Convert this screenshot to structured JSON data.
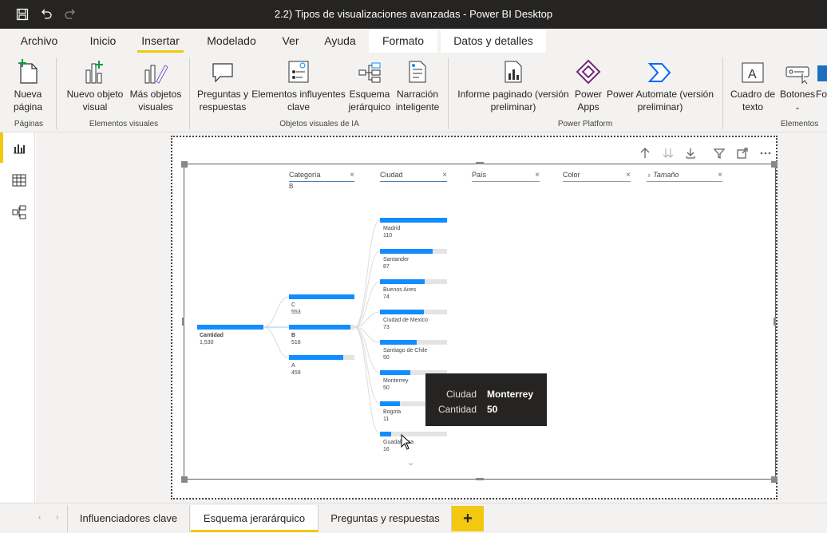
{
  "window": {
    "title": "2.2) Tipos de visualizaciones avanzadas - Power BI Desktop",
    "quick_access": [
      "save-icon",
      "undo-icon",
      "redo-icon"
    ]
  },
  "tabs": [
    {
      "label": "Archivo",
      "active": false
    },
    {
      "label": "Inicio",
      "active": false
    },
    {
      "label": "Insertar",
      "active": true
    },
    {
      "label": "Modelado",
      "active": false
    },
    {
      "label": "Ver",
      "active": false
    },
    {
      "label": "Ayuda",
      "active": false
    },
    {
      "label": "Formato",
      "active": false,
      "contextual": true
    },
    {
      "label": "Datos y detalles",
      "active": false,
      "contextual": true
    }
  ],
  "ribbon": {
    "buttons": {
      "nueva_pagina": "Nueva página",
      "nuevo_objeto_visual": "Nuevo objeto visual",
      "mas_objetos_visuales": "Más objetos visuales",
      "preguntas_respuestas": "Preguntas y respuestas",
      "elementos_influyentes": "Elementos influyentes clave",
      "esquema_jerarquico": "Esquema jerárquico",
      "narracion_inteligente": "Narración inteligente",
      "informe_paginado": "Informe paginado (versión preliminar)",
      "power_apps": "Power Apps",
      "power_automate": "Power Automate (versión preliminar)",
      "cuadro_texto": "Cuadro de texto",
      "botones": "Botones",
      "formas": "Fo"
    },
    "groups": {
      "paginas": "Páginas",
      "elementos_visuales": "Elementos visuales",
      "objetos_visuales_ia": "Objetos visuales de IA",
      "power_platform": "Power Platform",
      "elementos": "Elementos"
    }
  },
  "leftrail": [
    "report-view-icon",
    "data-view-icon",
    "model-view-icon"
  ],
  "decomposition_tree": {
    "columns": [
      {
        "label": "Categoría",
        "sub": "B"
      },
      {
        "label": "Ciudad",
        "sub": ""
      },
      {
        "label": "País",
        "sub": ""
      },
      {
        "label": "Color",
        "sub": ""
      },
      {
        "label": "Tamaño",
        "sub": ""
      }
    ],
    "root": {
      "label": "Cantidad",
      "value": "1,530"
    },
    "level1": [
      {
        "label": "C",
        "value": "553",
        "fill": 1.0
      },
      {
        "label": "B",
        "value": "518",
        "fill": 0.94
      },
      {
        "label": "A",
        "value": "459",
        "fill": 0.83
      }
    ],
    "level2": [
      {
        "label": "Madrid",
        "value": "110",
        "fill": 1.0
      },
      {
        "label": "Santander",
        "value": "87",
        "fill": 0.79
      },
      {
        "label": "Buenos Aires",
        "value": "74",
        "fill": 0.67
      },
      {
        "label": "Ciudad de Mexico",
        "value": "73",
        "fill": 0.66
      },
      {
        "label": "Santiago de Chile",
        "value": "50",
        "fill": 0.55
      },
      {
        "label": "Monterrey",
        "value": "50",
        "fill": 0.45
      },
      {
        "label": "Bogota",
        "value": "11",
        "fill": 0.3
      },
      {
        "label": "Guadalajara",
        "value": "16",
        "fill": 0.17
      }
    ],
    "tooltip": {
      "k1": "Ciudad",
      "v1": "Monterrey",
      "k2": "Cantidad",
      "v2": "50"
    }
  },
  "page_tabs": [
    {
      "label": "Influenciadores clave",
      "active": false
    },
    {
      "label": "Esquema jerarárquico",
      "active": true
    },
    {
      "label": "Preguntas y respuestas",
      "active": false
    }
  ],
  "add_page": "+"
}
